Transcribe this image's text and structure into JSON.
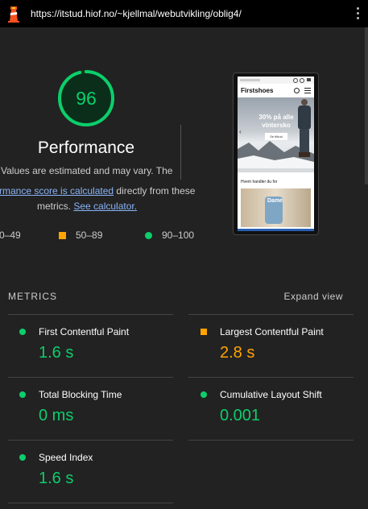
{
  "browser": {
    "url": "https://itstud.hiof.no/~kjellmal/webutvikling/oblig4/"
  },
  "score": {
    "value": "96",
    "fraction": 0.96,
    "title": "Performance",
    "color": "#0cce6b"
  },
  "description": {
    "line1": "Values are estimated and may vary. The",
    "line2_link": "rmance score is calculated",
    "line2_rest": " directly from these",
    "line3_pre": "metrics. ",
    "line3_link": "See calculator."
  },
  "legend": {
    "fail": "0–49",
    "average": "50–89",
    "pass": "90–100"
  },
  "preview": {
    "brand": "Firstshoes",
    "banner_text": "30% på alle vintersko",
    "banner_button": "Se tilbud",
    "section_title": "Hvem handler du for",
    "card_label": "Dame"
  },
  "metrics": {
    "heading": "METRICS",
    "expand": "Expand view",
    "fcp": {
      "name": "First Contentful Paint",
      "value": "1.6 s",
      "status": "pass"
    },
    "lcp": {
      "name": "Largest Contentful Paint",
      "value": "2.8 s",
      "status": "average"
    },
    "tbt": {
      "name": "Total Blocking Time",
      "value": "0 ms",
      "status": "pass"
    },
    "cls": {
      "name": "Cumulative Layout Shift",
      "value": "0.001",
      "status": "pass"
    },
    "si": {
      "name": "Speed Index",
      "value": "1.6 s",
      "status": "pass"
    }
  },
  "colors": {
    "pass": "#0cce6b",
    "average": "#ffa400",
    "background": "#222222"
  }
}
